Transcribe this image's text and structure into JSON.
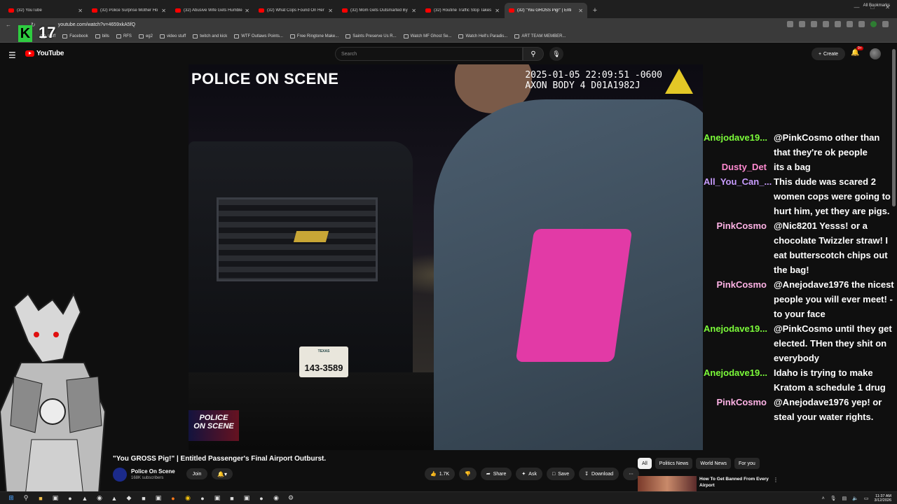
{
  "browser": {
    "tabs": [
      {
        "label": "(32) YouTube",
        "active": false
      },
      {
        "label": "(32) Police Surprise Mother Ho",
        "active": false
      },
      {
        "label": "(32) Abusive Wife Gets Humble",
        "active": false
      },
      {
        "label": "(32) What Cops Found On Her",
        "active": false
      },
      {
        "label": "(32) Mom Gets Outsmarted By",
        "active": false
      },
      {
        "label": "(32) Routine Traffic Stop Takes",
        "active": false
      },
      {
        "label": "(32) \"You GROSS Pig!\" | Enti",
        "active": true
      }
    ],
    "new_tab": "+",
    "url": "youtube.com/watch?v=4659xkA5fQ",
    "bookmarks": [
      "stuff",
      "Facebook",
      "bills",
      "RFS",
      "eg2",
      "video stuff",
      "twitch and kick",
      "WTF Outlaws Points...",
      "Free Ringtone Make...",
      "Saints Preserve Us R...",
      "Watch MF Ghost Se...",
      "Watch Hell's Paradis...",
      "ART TEAM MEMBER..."
    ],
    "all_bookmarks": "All Bookmarks"
  },
  "overlay": {
    "k_badge": "K",
    "count": "17"
  },
  "youtube": {
    "logo": "YouTube",
    "search_placeholder": "Search",
    "create_label": "Create",
    "notification_count": "9+"
  },
  "video": {
    "overlay_title": "POLICE ON SCENE",
    "timestamp": "2025-01-05 22:09:51 -0600",
    "camera": "AXON BODY 4 D01A1982J",
    "plate_state": "TEXAS",
    "plate_number": "143-3589",
    "logo_line1": "POLICE",
    "logo_line2": "ON SCENE",
    "title": "\"You GROSS Pig!\" | Entitled Passenger's Final Airport Outburst.",
    "channel": "Police On Scene",
    "subscribers": "168K subscribers",
    "join": "Join",
    "likes": "1.7K",
    "share": "Share",
    "ask": "Ask",
    "save": "Save",
    "download": "Download"
  },
  "chat": [
    {
      "user": "Anejodave19...",
      "color": "#7cfc3a",
      "text": "@PinkCosmo other than that they're ok people"
    },
    {
      "user": "Dusty_Det",
      "color": "#ff8ad0",
      "text": "its a bag"
    },
    {
      "user": "All_You_Can_...",
      "color": "#c89cff",
      "text": "This dude was scared 2 women cops were going to hurt him, yet they are pigs."
    },
    {
      "user": "PinkCosmo",
      "color": "#ffb3e6",
      "text": "@Nic8201 Yesss! or a chocolate Twizzler straw! I eat butterscotch chips out the bag!"
    },
    {
      "user": "PinkCosmo",
      "color": "#ffb3e6",
      "text": "@Anejodave1976 the nicest people you will ever meet! - to your face"
    },
    {
      "user": "Anejodave19...",
      "color": "#7cfc3a",
      "text": "@PinkCosmo until they get elected. THen they shit on everybody"
    },
    {
      "user": "Anejodave19...",
      "color": "#7cfc3a",
      "text": "Idaho is trying to make Kratom a schedule 1 drug"
    },
    {
      "user": "PinkCosmo",
      "color": "#ffb3e6",
      "text": "@Anejodave1976 yep! or steal your water rights."
    }
  ],
  "sidebar": {
    "chips": [
      "All",
      "Politics News",
      "World News",
      "For you"
    ],
    "recommendation": "How To Get Banned From Every Airport"
  },
  "taskbar": {
    "time": "11:37 AM",
    "date": "3/12/2026"
  }
}
